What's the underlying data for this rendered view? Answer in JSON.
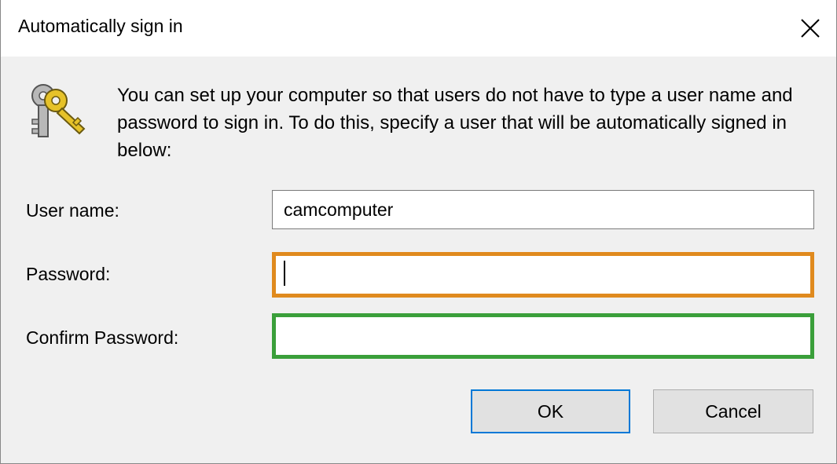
{
  "window": {
    "title": "Automatically sign in"
  },
  "description": "You can set up your computer so that users do not have to type a user name and password to sign in. To do this, specify a user that will be automatically signed in below:",
  "icons": {
    "header": "keys-icon",
    "close": "close-icon"
  },
  "fields": {
    "username": {
      "label": "User name:",
      "value": "camcomputer"
    },
    "password": {
      "label": "Password:",
      "value": ""
    },
    "confirm_password": {
      "label": "Confirm Password:",
      "value": ""
    }
  },
  "buttons": {
    "ok": "OK",
    "cancel": "Cancel"
  },
  "colors": {
    "password_highlight": "#e08a1e",
    "confirm_highlight": "#3a9f3a",
    "default_button_border": "#0078d7"
  }
}
